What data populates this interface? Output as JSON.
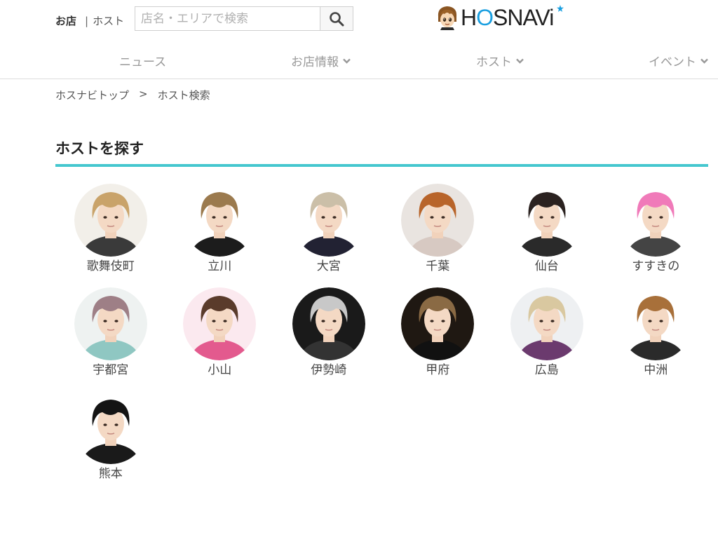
{
  "header": {
    "toggle": {
      "shop_label": "お店",
      "separator": "|",
      "host_label": "ホスト"
    },
    "search": {
      "placeholder": "店名・エリアで検索",
      "icon": "search-icon"
    },
    "logo": {
      "text_h": "H",
      "text_o": "O",
      "text_rest": "SNAVi",
      "brand_color": "#1a9fe0"
    }
  },
  "nav": [
    {
      "label": "ニュース",
      "has_dropdown": false
    },
    {
      "label": "お店情報",
      "has_dropdown": true
    },
    {
      "label": "ホスト",
      "has_dropdown": true
    },
    {
      "label": "イベント",
      "has_dropdown": true
    }
  ],
  "breadcrumb": {
    "home": "ホスナビトップ",
    "separator": ">",
    "current": "ホスト検索"
  },
  "section": {
    "title": "ホスト を探す",
    "title_text": "ホストを探す",
    "accent_color": "#45c7cf"
  },
  "areas": [
    {
      "name": "歌舞伎町",
      "hair": "#c9a36a",
      "bg": "#f2efe9",
      "cloth": "#3a3a3a"
    },
    {
      "name": "立川",
      "hair": "#9b7a4e",
      "bg": "#ffffff",
      "cloth": "#1c1c1c"
    },
    {
      "name": "大宮",
      "hair": "#cbbfa8",
      "bg": "#ffffff",
      "cloth": "#222233"
    },
    {
      "name": "千葉",
      "hair": "#b8642a",
      "bg": "#e9e4e0",
      "cloth": "#d7c9c2"
    },
    {
      "name": "仙台",
      "hair": "#2b2220",
      "bg": "#ffffff",
      "cloth": "#2a2a2a"
    },
    {
      "name": "すすきの",
      "hair": "#f07ab9",
      "bg": "#ffffff",
      "cloth": "#444444"
    },
    {
      "name": "宇都宮",
      "hair": "#9e7f86",
      "bg": "#eef2f1",
      "cloth": "#8fc7c2"
    },
    {
      "name": "小山",
      "hair": "#5a3b2b",
      "bg": "#fbe9ef",
      "cloth": "#e35a8e"
    },
    {
      "name": "伊勢崎",
      "hair": "#c8c8c8",
      "bg": "#1a1a1a",
      "cloth": "#333333"
    },
    {
      "name": "甲府",
      "hair": "#8a6a44",
      "bg": "#1f1812",
      "cloth": "#111111"
    },
    {
      "name": "広島",
      "hair": "#d9c8a0",
      "bg": "#eef0f2",
      "cloth": "#6b3a6e"
    },
    {
      "name": "中洲",
      "hair": "#a8703a",
      "bg": "#ffffff",
      "cloth": "#2a2a2a"
    },
    {
      "name": "熊本",
      "hair": "#141414",
      "bg": "#ffffff",
      "cloth": "#1a1a1a"
    }
  ]
}
